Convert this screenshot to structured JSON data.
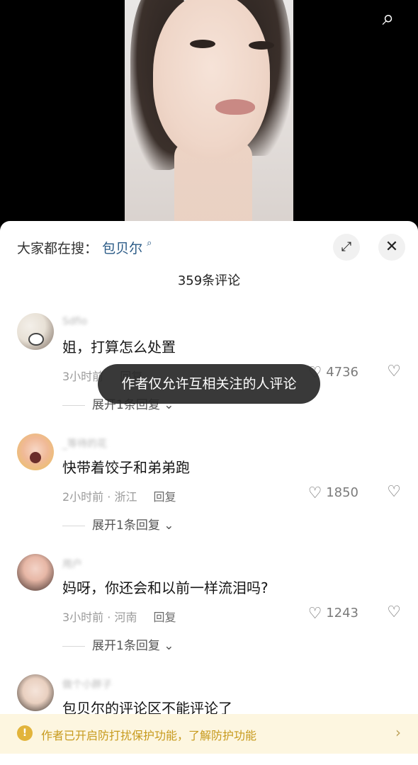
{
  "top": {
    "search_icon": "search-icon"
  },
  "sheet": {
    "hot_search_prefix": "大家都在搜：",
    "hot_search_keyword": "包贝尔",
    "count_label": "359条评论",
    "expand_icon": "expand-icon",
    "close_icon": "close-icon"
  },
  "comments": [
    {
      "username": "Sdfio",
      "text": "姐，打算怎么处置",
      "time_location": "3小时前",
      "reply": "回复",
      "likes": "4736",
      "expand": "展开1条回复"
    },
    {
      "username": "_等待的花",
      "text": "快带着饺子和弟弟跑",
      "time_location": "2小时前 · 浙江",
      "reply": "回复",
      "likes": "1850",
      "expand": "展开1条回复"
    },
    {
      "username": "用户",
      "text": "妈呀，你还会和以前一样流泪吗?",
      "time_location": "3小时前 · 河南",
      "reply": "回复",
      "likes": "1243",
      "expand": "展开1条回复"
    },
    {
      "username": "做个小胖子",
      "text": "包贝尔的评论区不能评论了"
    }
  ],
  "toast": "作者仅允许互相关注的人评论",
  "notice": {
    "text": "作者已开启防打扰保护功能，了解防护功能",
    "accent": "#c79a1d"
  }
}
